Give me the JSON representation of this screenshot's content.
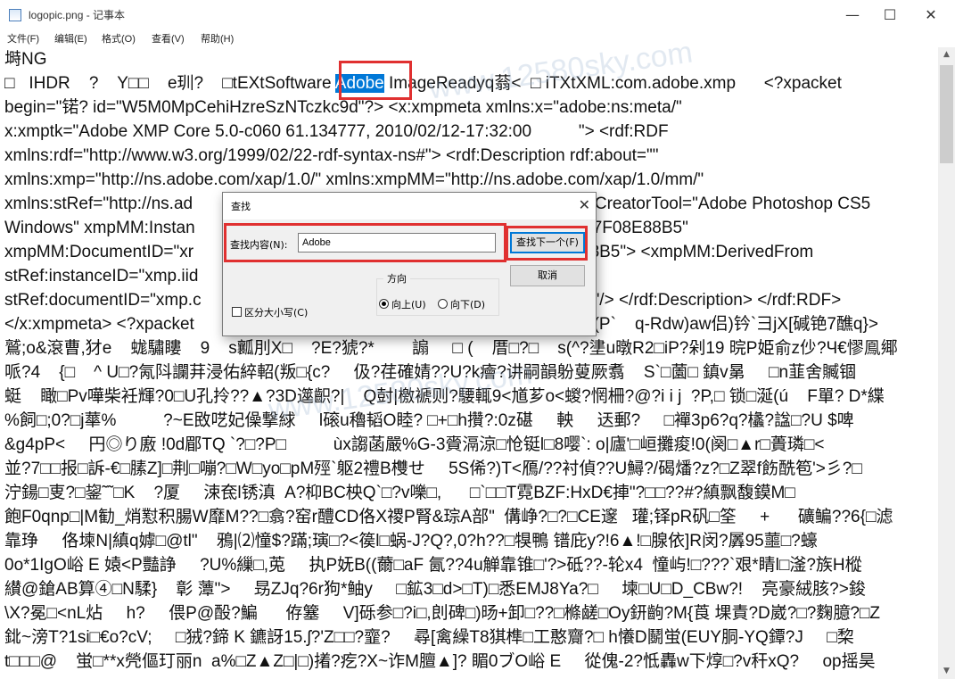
{
  "window": {
    "title": "logopic.png - 记事本",
    "minimize": "—",
    "maximize": "☐",
    "close": "✕"
  },
  "menu": [
    "文件(F)",
    "编辑(E)",
    "格式(O)",
    "查看(V)",
    "帮助(H)"
  ],
  "editor": {
    "lines": [
      "塒NG",
      "□   IHDR    ?    Y□□    e玔?    □tEXtSoftware ",
      "begin=\"锘? id=\"W5M0MpCehiHzreSzNTczkc9d\"?> <x:xmpmeta xmlns:x=\"adobe:ns:meta/\"",
      "x:xmptk=\"Adobe XMP Core 5.0-c060 61.134777, 2010/02/12-17:32:00          \"> <rdf:RDF",
      "xmlns:rdf=\"http://www.w3.org/1999/02/22-rdf-syntax-ns#\"> <rdf:Description rdf:about=\"\"",
      "xmlns:xmp=\"http://ns.adobe.com/xap/1.0/\" xmlns:xmpMM=\"http://ns.adobe.com/xap/1.0/mm/\"",
      "xmlns:stRef=\"http://ns.ad",
      "Windows\" xmpMM:Instan",
      "xmpMM:DocumentID=\"xr",
      "stRef:instanceID=\"xmp.iid",
      "stRef:documentID=\"xmp.c",
      "</x:xmpmeta> <?xpacket",
      "鷲;o&滾曹,犲e    蛖驌瞜    9    s瓤刖X□    ?E?猇?*        謆     □ (    厝□?□    s(^?堻u暾R2□iP?剁19 晥P姫俞z仯?Ч€憀鳯鄊",
      "哌?4    {□    ^ U□?氝阧讕荓浸佑綷軺(叛□{c?     伋?荏確婧??U?k癐?讲嗣韻躮蓃厥翥    S`□薗□ 鎮v晜     □n韮舍贓锢",
      "蜓    瞰□Pv嘩柴衽輝?0□U孔拎??▲?3D遾齞?|    Q尌|檄褫则?騕輒9<馗芗o<蝬?惘柵?@?i i j  ?P,□ 锁□涎(ú    F單? D*緤",
      "%飼□;0?□j蕐%          ?~E敃呓妃僺撃絿     l磙u穭韬O睦? □+□h攢?:0z碪     軮     迗郵?     □襌3p6?q?欚?諡□?U $啤",
      "&g4pP<     円◎り廒 !0d郿TQ `?□?P□          ùx謅菡嚴%G-3賫滆涼□怆铤l□8嘤`: o|廬'□峘攤痠!0(阕□▲r□蕢璘□<",
      "並?7□□报□訴-€□膆Z]□荆□嘣?□W□yo□pM殌`躯2禮B欆せ     5S俙?)T<鴈/??衬偵??U鱘?/碣燔?z?□Z翠f飭酰笣'>彡?□",
      "泞鍚□叓?□鋆˜˜□K    ?厦     涑奃l锈滇  A?枊BC柍Q`□?v嚛□,      □`□□T霓BZF:HxD€捙\"?□□??#?縝飘馥鏌M□",
      "飽F0qnp□|M勧_焇懟积腸W靡M??□翕?窑r醴CD佫X禝P腎&琮A部\"  傋峥?□?□CE邃   瓘;铎pR矾□筌     +      礦鳊??6{□滤",
      "靠琤     佫堜N|縝q嫭□@tl\"    鴉|⑵憧$?蹣;璌□?<篌l□蜗-J?Q?,0?h??□犑鴨 镨庇y?!6▲!□腺依]R闵?羼95蘁□?蠔",
      "0o*1IgO峪 E 媴<P豔諍     ?U%繅□,莵     执P妩B((薾□aF 氤??4u觯靠锥□'?>砥??-轮x4  憧屿!□???`艰*睛l□滏?族H樅",
      "纉@鎗AB算④□N騥}    彰 藫\">     昮ZJq?6r狗*鲉y     □鉱3□d>□T)□悉EMJ8Ya?□     堜□U□D_CBw?!    亮豪絨胲?>鋑",
      "\\X?冕□<nL炶     h?     偎P@酘?鯿      侟簺     V]砾参□?i□,剆碑□)旸+卸□??□樤鹾□Oy鈃齣?M{莨 堁責?D崴?□?麴臆?□Z",
      "鉳~滂T?1si□€o?cV;     □狨?鍗 K 鑣訝15.ʃ?'Z□□?韲?     尋[禽繰T8猉榫□工憨齎?□ h懩D鬭蛍(EUY胴-YQ鐔?J     □棃",
      "t□□□@    蛍□**x焭傴玎丽n  a%□Z▲Z□|□)撯?疙?X~诈M膻▲]? 睸0ブO峪 E     從傀-2?怟轟w下焞□?v秆xQ?     op摇昊"
    ],
    "line1_highlight": "Adobe",
    "line1_tail": " ImageReadyq蓊<  □ iTXtXML:com.adobe.xmp      <?xpacket",
    "right_frag_6": "p:CreatorTool=\"Adobe Photoshop CS5",
    "right_frag_7": "D7F08E88B5\"",
    "right_frag_8": "88B5\"> <xmpMM:DerivedFrom",
    "right_frag_10": "5\"/> </rdf:Description> </rdf:RDF>",
    "right_frag_11": "?(P`    q-Rdw)aw侣)钤`彐jX[碱铯7醮q}>"
  },
  "watermark": "www.12580sky.com",
  "find_dialog": {
    "title": "查找",
    "close": "✕",
    "find_label": "查找内容(N):",
    "find_value": "Adobe",
    "find_next": "查找下一个(F)",
    "cancel": "取消",
    "direction_label": "方向",
    "up_label": "向上(U)",
    "down_label": "向下(D)",
    "direction_selected": "向上(U)",
    "match_case": "区分大小写(C)",
    "match_case_checked": false
  },
  "colors": {
    "highlight": "#0078d7",
    "annotation": "#e03030"
  }
}
